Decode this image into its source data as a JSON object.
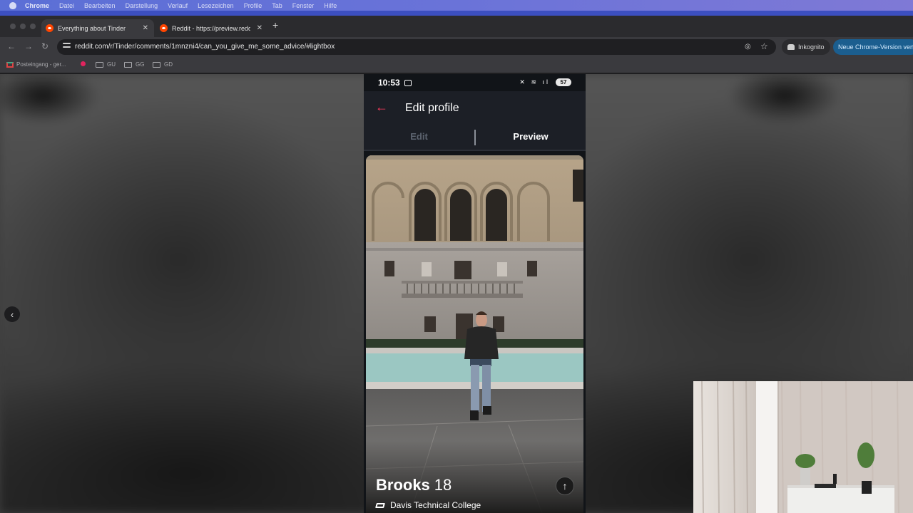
{
  "menubar": {
    "app": "Chrome",
    "items": [
      "Datei",
      "Bearbeiten",
      "Darstellung",
      "Verlauf",
      "Lesezeichen",
      "Profile",
      "Tab",
      "Fenster",
      "Hilfe"
    ]
  },
  "tabs": [
    {
      "title": "Everything about Tinder",
      "active": true
    },
    {
      "title": "Reddit - https://preview.redd",
      "active": false
    }
  ],
  "toolbar": {
    "url": "reddit.com/r/Tinder/comments/1mnzni4/can_you_give_me_some_advice/#lightbox",
    "incognito_label": "Inkognito",
    "update_label": "Neue Chrome-Version verfügbar"
  },
  "bookmarks": [
    {
      "label": "Posteingang - ger...",
      "icon": "gmail-icon"
    },
    {
      "label": "",
      "icon": "dot-icon"
    },
    {
      "label": "GU",
      "icon": "folder-icon"
    },
    {
      "label": "GG",
      "icon": "folder-icon"
    },
    {
      "label": "GD",
      "icon": "folder-icon"
    }
  ],
  "phone": {
    "time": "10:53",
    "battery": "57",
    "header_title": "Edit profile",
    "seg_edit": "Edit",
    "seg_preview": "Preview",
    "profile_name": "Brooks",
    "profile_age": "18",
    "profile_school": "Davis Technical College"
  },
  "colors": {
    "tinder_accent": "#fd3a5c",
    "update_button": "#1b5e8f",
    "menubar": "#5b6fd6"
  }
}
